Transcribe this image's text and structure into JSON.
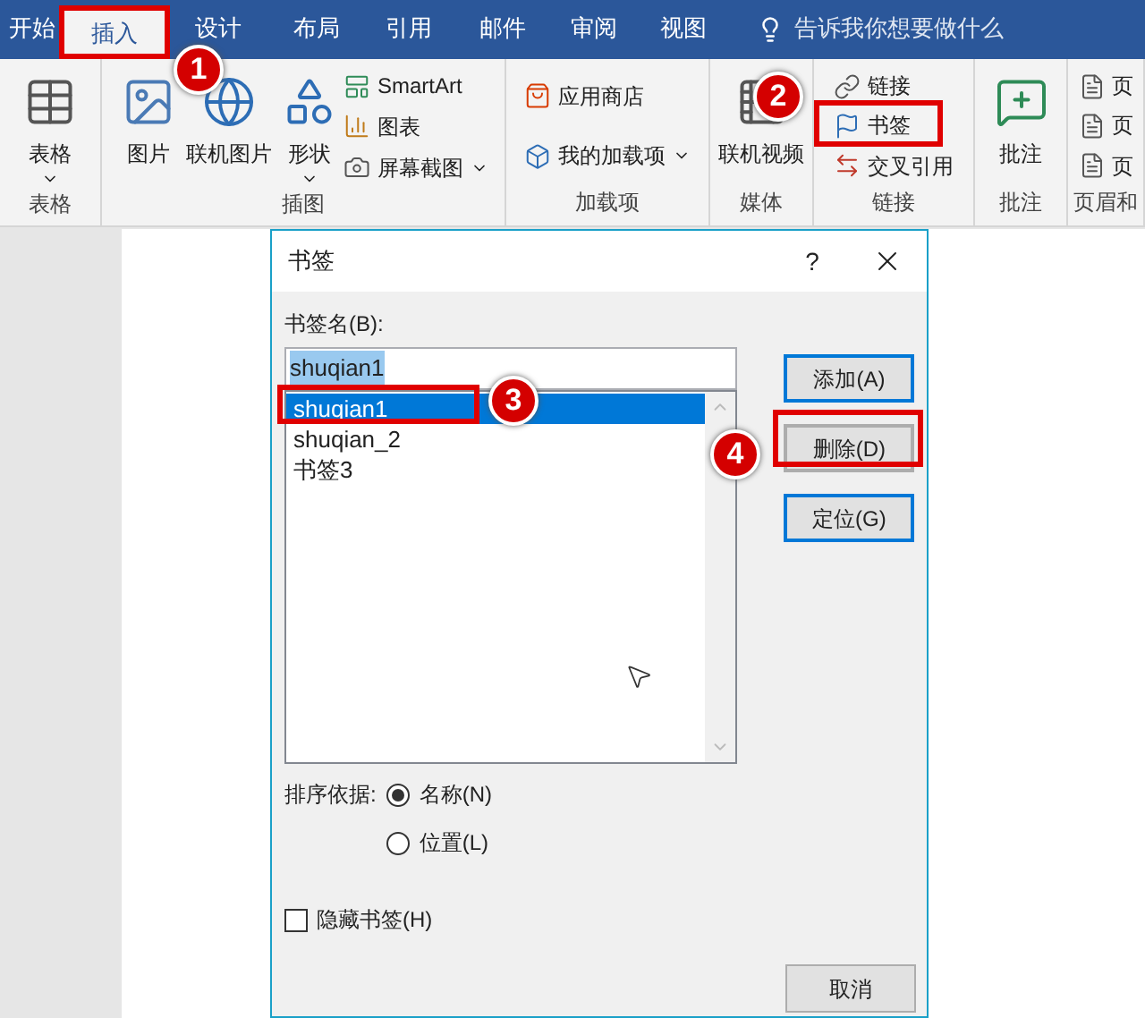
{
  "tabs": [
    {
      "label": "开始",
      "selected": false
    },
    {
      "label": "插入",
      "selected": true
    },
    {
      "label": "设计",
      "selected": false
    },
    {
      "label": "布局",
      "selected": false
    },
    {
      "label": "引用",
      "selected": false
    },
    {
      "label": "邮件",
      "selected": false
    },
    {
      "label": "审阅",
      "selected": false
    },
    {
      "label": "视图",
      "selected": false
    }
  ],
  "tell_me": {
    "placeholder": "告诉我你想要做什么"
  },
  "ribbon_groups": [
    {
      "label": "表格",
      "items": [
        {
          "kind": "large",
          "label": "表格",
          "dropdown": true
        }
      ]
    },
    {
      "label": "插图",
      "items": [
        {
          "kind": "large",
          "label": "图片"
        },
        {
          "kind": "large",
          "label": "联机图片"
        },
        {
          "kind": "large",
          "label": "形状",
          "dropdown": true
        },
        {
          "kind": "stack",
          "entries": [
            {
              "label": "SmartArt"
            },
            {
              "label": "图表"
            },
            {
              "label": "屏幕截图",
              "dropdown": true
            }
          ]
        }
      ]
    },
    {
      "label": "加载项",
      "items": [
        {
          "kind": "stack",
          "entries": [
            {
              "label": "应用商店"
            },
            {
              "label": "我的加载项",
              "dropdown": true
            }
          ]
        }
      ]
    },
    {
      "label": "媒体",
      "items": [
        {
          "kind": "large",
          "label": "联机视频"
        }
      ]
    },
    {
      "label": "链接",
      "items": [
        {
          "kind": "stack",
          "entries": [
            {
              "label": "链接"
            },
            {
              "label": "书签"
            },
            {
              "label": "交叉引用"
            }
          ]
        }
      ]
    },
    {
      "label": "批注",
      "items": [
        {
          "kind": "large",
          "label": "批注"
        }
      ]
    },
    {
      "label": "页眉和",
      "items": [
        {
          "kind": "stack",
          "entries": [
            {
              "label": "页"
            },
            {
              "label": "页"
            },
            {
              "label": "页"
            }
          ]
        }
      ]
    }
  ],
  "dialog": {
    "title": "书签",
    "help": "?",
    "name_label": "书签名(B):",
    "name_value": "shuqian1",
    "list": [
      {
        "label": "shuqian1",
        "selected": true
      },
      {
        "label": "shuqian_2",
        "selected": false
      },
      {
        "label": "书签3",
        "selected": false
      }
    ],
    "buttons": [
      {
        "label": "添加(A)",
        "default": true
      },
      {
        "label": "删除(D)",
        "default": false
      },
      {
        "label": "定位(G)",
        "default": true
      }
    ],
    "sort_label": "排序依据:",
    "sort_options": [
      {
        "label": "名称(N)",
        "selected": true
      },
      {
        "label": "位置(L)",
        "selected": false
      }
    ],
    "hidden_bookmarks": {
      "label": "隐藏书签(H)",
      "checked": false
    },
    "cancel": "取消"
  },
  "callouts": [
    {
      "label": "1"
    },
    {
      "label": "2"
    },
    {
      "label": "3"
    },
    {
      "label": "4"
    }
  ]
}
